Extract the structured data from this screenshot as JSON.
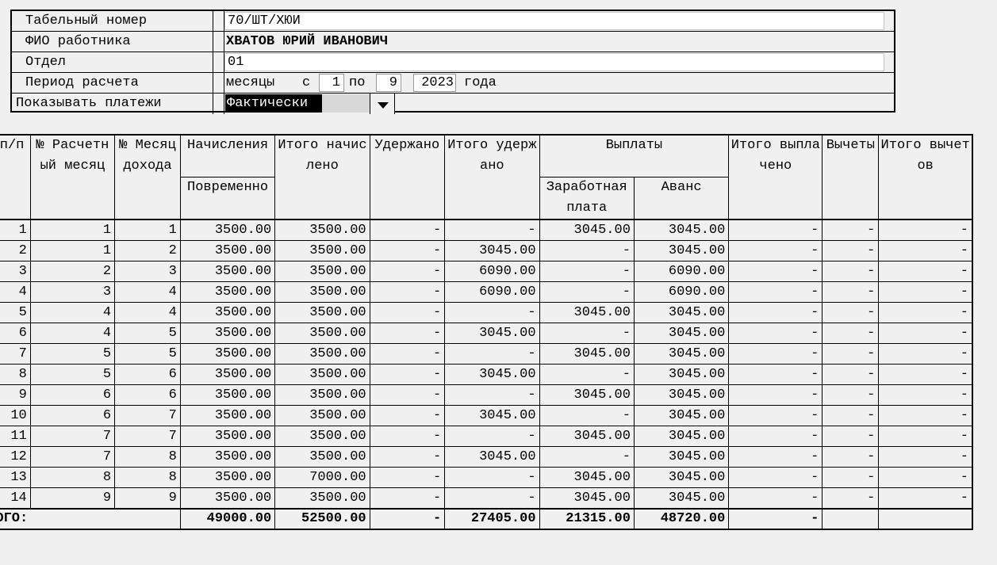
{
  "form": {
    "tab_label": "Табельный номер",
    "tab_value": "70/ШТ/ХЮИ",
    "fio_label": "ФИО работника",
    "fio_value": "ХВАТОВ ЮРИЙ ИВАНОВИЧ",
    "dept_label": "Отдел",
    "dept_value": "01",
    "period_label": "Период расчета",
    "period_months": "месяцы",
    "period_from": "с",
    "period_from_value": "1",
    "period_to": "по",
    "period_to_value": "9",
    "period_year_value": "2023",
    "period_year_suffix": "года",
    "show_label": "Показывать платежи",
    "show_value": "Фактически"
  },
  "table": {
    "headers": {
      "npp": "№ п/п",
      "calc_month": "№ Расчетный месяц",
      "income_month": "№ Месяц дохода",
      "accruals": "Начисления",
      "accruals_sub": "Повременно",
      "total_accrued": "Итого начислено",
      "withheld": "Удержано",
      "total_withheld": "Итого удержано",
      "payments": "Выплаты",
      "salary": "Заработная плата",
      "advance": "Аванс",
      "total_paid": "Итого выплачено",
      "deductions": "Вычеты",
      "total_deductions": "Итого вычетов"
    },
    "rows": [
      {
        "n": "1",
        "cm": "1",
        "im": "1",
        "acc": "3500.00",
        "tacc": "3500.00",
        "wh": "-",
        "twh": "-",
        "sal": "3045.00",
        "adv": "3045.00",
        "tpaid": "-",
        "ded": "-",
        "tded": "-"
      },
      {
        "n": "2",
        "cm": "1",
        "im": "2",
        "acc": "3500.00",
        "tacc": "3500.00",
        "wh": "-",
        "twh": "3045.00",
        "sal": "-",
        "adv": "3045.00",
        "tpaid": "-",
        "ded": "-",
        "tded": "-"
      },
      {
        "n": "3",
        "cm": "2",
        "im": "3",
        "acc": "3500.00",
        "tacc": "3500.00",
        "wh": "-",
        "twh": "6090.00",
        "sal": "-",
        "adv": "6090.00",
        "tpaid": "-",
        "ded": "-",
        "tded": "-"
      },
      {
        "n": "4",
        "cm": "3",
        "im": "4",
        "acc": "3500.00",
        "tacc": "3500.00",
        "wh": "-",
        "twh": "6090.00",
        "sal": "-",
        "adv": "6090.00",
        "tpaid": "-",
        "ded": "-",
        "tded": "-"
      },
      {
        "n": "5",
        "cm": "4",
        "im": "4",
        "acc": "3500.00",
        "tacc": "3500.00",
        "wh": "-",
        "twh": "-",
        "sal": "3045.00",
        "adv": "3045.00",
        "tpaid": "-",
        "ded": "-",
        "tded": "-"
      },
      {
        "n": "6",
        "cm": "4",
        "im": "5",
        "acc": "3500.00",
        "tacc": "3500.00",
        "wh": "-",
        "twh": "3045.00",
        "sal": "-",
        "adv": "3045.00",
        "tpaid": "-",
        "ded": "-",
        "tded": "-"
      },
      {
        "n": "7",
        "cm": "5",
        "im": "5",
        "acc": "3500.00",
        "tacc": "3500.00",
        "wh": "-",
        "twh": "-",
        "sal": "3045.00",
        "adv": "3045.00",
        "tpaid": "-",
        "ded": "-",
        "tded": "-"
      },
      {
        "n": "8",
        "cm": "5",
        "im": "6",
        "acc": "3500.00",
        "tacc": "3500.00",
        "wh": "-",
        "twh": "3045.00",
        "sal": "-",
        "adv": "3045.00",
        "tpaid": "-",
        "ded": "-",
        "tded": "-"
      },
      {
        "n": "9",
        "cm": "6",
        "im": "6",
        "acc": "3500.00",
        "tacc": "3500.00",
        "wh": "-",
        "twh": "-",
        "sal": "3045.00",
        "adv": "3045.00",
        "tpaid": "-",
        "ded": "-",
        "tded": "-"
      },
      {
        "n": "10",
        "cm": "6",
        "im": "7",
        "acc": "3500.00",
        "tacc": "3500.00",
        "wh": "-",
        "twh": "3045.00",
        "sal": "-",
        "adv": "3045.00",
        "tpaid": "-",
        "ded": "-",
        "tded": "-"
      },
      {
        "n": "11",
        "cm": "7",
        "im": "7",
        "acc": "3500.00",
        "tacc": "3500.00",
        "wh": "-",
        "twh": "-",
        "sal": "3045.00",
        "adv": "3045.00",
        "tpaid": "-",
        "ded": "-",
        "tded": "-"
      },
      {
        "n": "12",
        "cm": "7",
        "im": "8",
        "acc": "3500.00",
        "tacc": "3500.00",
        "wh": "-",
        "twh": "3045.00",
        "sal": "-",
        "adv": "3045.00",
        "tpaid": "-",
        "ded": "-",
        "tded": "-"
      },
      {
        "n": "13",
        "cm": "8",
        "im": "8",
        "acc": "3500.00",
        "tacc": "7000.00",
        "wh": "-",
        "twh": "-",
        "sal": "3045.00",
        "adv": "3045.00",
        "tpaid": "-",
        "ded": "-",
        "tded": "-"
      },
      {
        "n": "14",
        "cm": "9",
        "im": "9",
        "acc": "3500.00",
        "tacc": "3500.00",
        "wh": "-",
        "twh": "-",
        "sal": "3045.00",
        "adv": "3045.00",
        "tpaid": "-",
        "ded": "-",
        "tded": "-"
      }
    ],
    "totals": {
      "label": "ИТОГО:",
      "acc": "49000.00",
      "tacc": "52500.00",
      "wh": "-",
      "twh": "27405.00",
      "sal": "21315.00",
      "adv": "48720.00",
      "tpaid": "-",
      "ded": "",
      "tded": ""
    }
  }
}
